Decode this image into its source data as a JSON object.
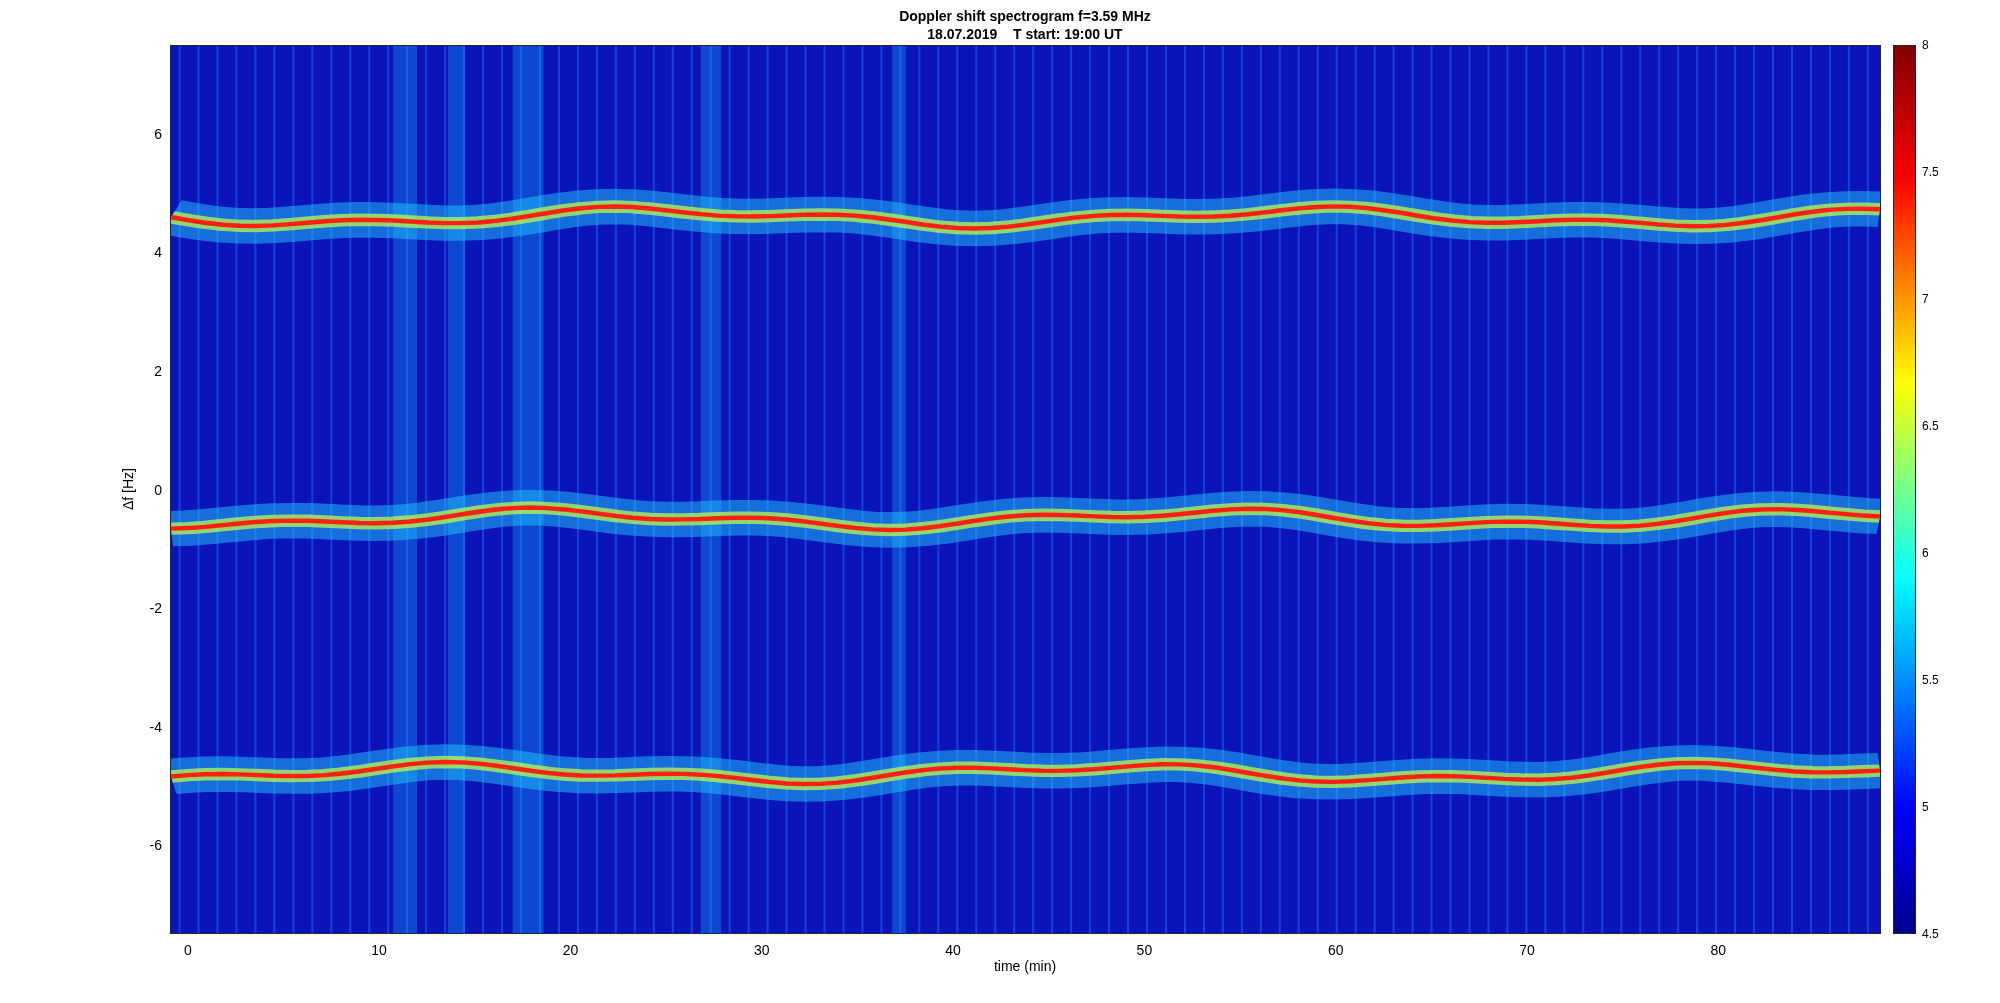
{
  "title": {
    "line1": "Doppler shift spectrogram f=3.59 MHz",
    "line2": "18.07.2019    T start: 19:00 UT"
  },
  "axes": {
    "xlabel": "time (min)",
    "ylabel": "Δf [Hz]",
    "xticks": [
      "0",
      "10",
      "20",
      "30",
      "40",
      "50",
      "60",
      "70",
      "80"
    ],
    "yticks": [
      "6",
      "4",
      "2",
      "0",
      "-2",
      "-4",
      "-6"
    ]
  },
  "colorbar": {
    "ticks": [
      "8",
      "7.5",
      "7",
      "6.5",
      "6",
      "5.5",
      "5",
      "4.5"
    ]
  }
}
